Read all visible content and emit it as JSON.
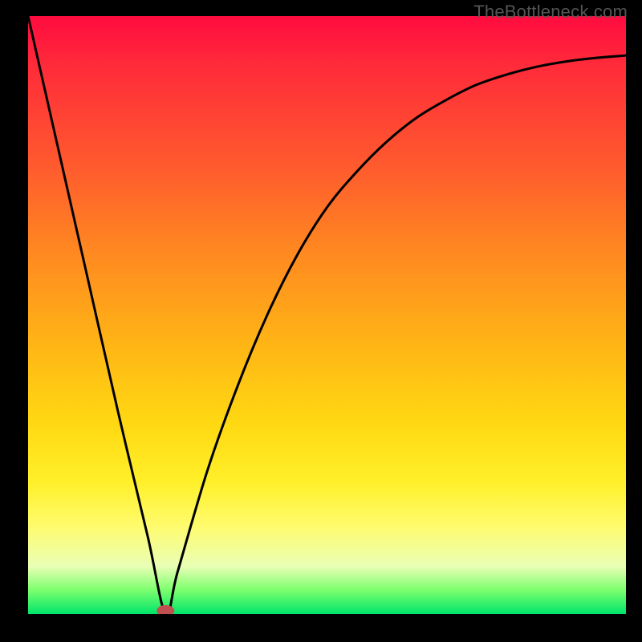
{
  "watermark": "TheBottleneck.com",
  "chart_data": {
    "type": "line",
    "title": "",
    "xlabel": "",
    "ylabel": "",
    "xlim": [
      0,
      100
    ],
    "ylim": [
      0,
      100
    ],
    "grid": false,
    "legend": false,
    "x": [
      0,
      5,
      10,
      15,
      20,
      23,
      25,
      30,
      35,
      40,
      45,
      50,
      55,
      60,
      65,
      70,
      75,
      80,
      85,
      90,
      95,
      100
    ],
    "values": [
      100,
      78,
      56,
      34,
      13,
      0,
      7,
      24,
      38,
      50,
      60,
      68,
      74,
      79,
      83,
      86,
      88.5,
      90.2,
      91.5,
      92.4,
      93,
      93.4
    ],
    "minimum_marker": {
      "x": 23,
      "y": 0,
      "color": "#c05050"
    },
    "background_gradient": {
      "stops": [
        {
          "pos": 0.0,
          "color": "#ff0b3f"
        },
        {
          "pos": 0.08,
          "color": "#ff2a3a"
        },
        {
          "pos": 0.25,
          "color": "#ff5a2e"
        },
        {
          "pos": 0.4,
          "color": "#ff8a20"
        },
        {
          "pos": 0.55,
          "color": "#ffb515"
        },
        {
          "pos": 0.68,
          "color": "#ffd812"
        },
        {
          "pos": 0.78,
          "color": "#fff02a"
        },
        {
          "pos": 0.85,
          "color": "#fffb6a"
        },
        {
          "pos": 0.92,
          "color": "#eaffb5"
        },
        {
          "pos": 0.96,
          "color": "#7cff6e"
        },
        {
          "pos": 1.0,
          "color": "#00e56a"
        }
      ]
    }
  }
}
